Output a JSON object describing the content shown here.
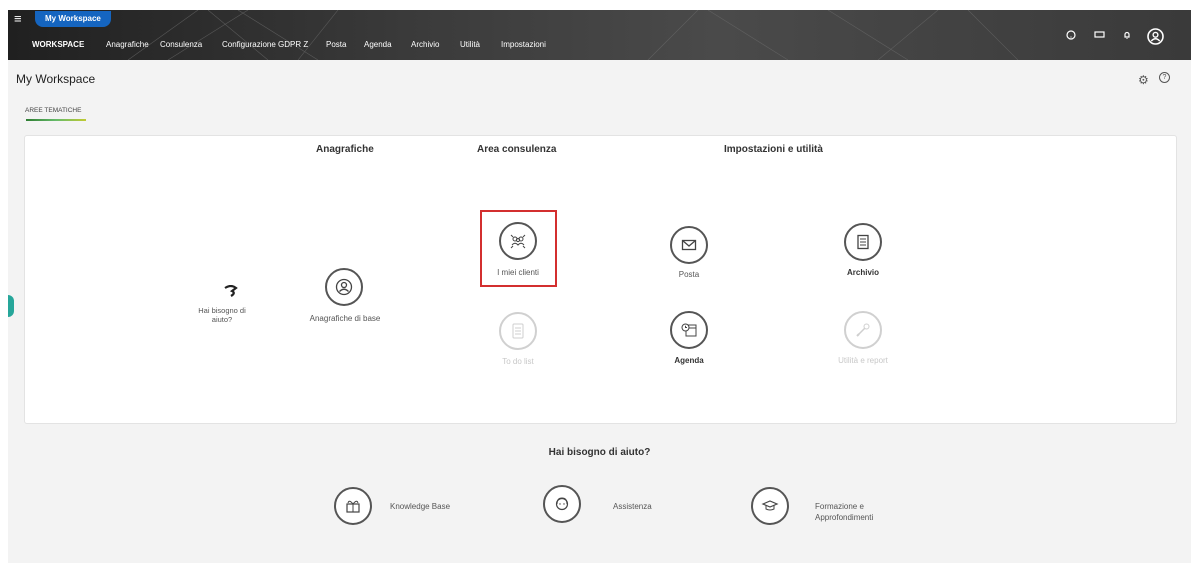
{
  "header": {
    "workspace_pill": "My Workspace",
    "menu": [
      {
        "label": "WORKSPACE",
        "active": true
      },
      {
        "label": "Anagrafiche"
      },
      {
        "label": "Consulenza"
      },
      {
        "label": "Configurazione GDPR Z"
      },
      {
        "label": "Posta"
      },
      {
        "label": "Agenda"
      },
      {
        "label": "Archivio"
      },
      {
        "label": "Utilità"
      },
      {
        "label": "Impostazioni"
      }
    ],
    "icons": [
      "help-icon",
      "screen-icon",
      "bell-icon",
      "user-icon"
    ]
  },
  "page": {
    "title": "My Workspace",
    "tab": "AREE TEMATICHE"
  },
  "sections": {
    "anagrafiche": "Anagrafiche",
    "consulenza": "Area consulenza",
    "impostazioni": "Impostazioni e utilità"
  },
  "items": {
    "help_text": "Hai bisogno di aiuto?",
    "anagrafiche_base": "Anagrafiche di base",
    "miei_clienti": "I miei clienti",
    "todo": "To do list",
    "posta": "Posta",
    "agenda": "Agenda",
    "archivio": "Archivio",
    "utilita": "Utilità e report"
  },
  "help_section": {
    "title": "Hai bisogno di aiuto?",
    "knowledge": "Knowledge Base",
    "assistenza": "Assistenza",
    "formazione": "Formazione e Approfondimenti"
  },
  "colors": {
    "header_dark": "#2b2b2b",
    "pill_blue": "#1565c0",
    "highlight_red": "#d32f2f",
    "accent_green": "#26a69a"
  }
}
